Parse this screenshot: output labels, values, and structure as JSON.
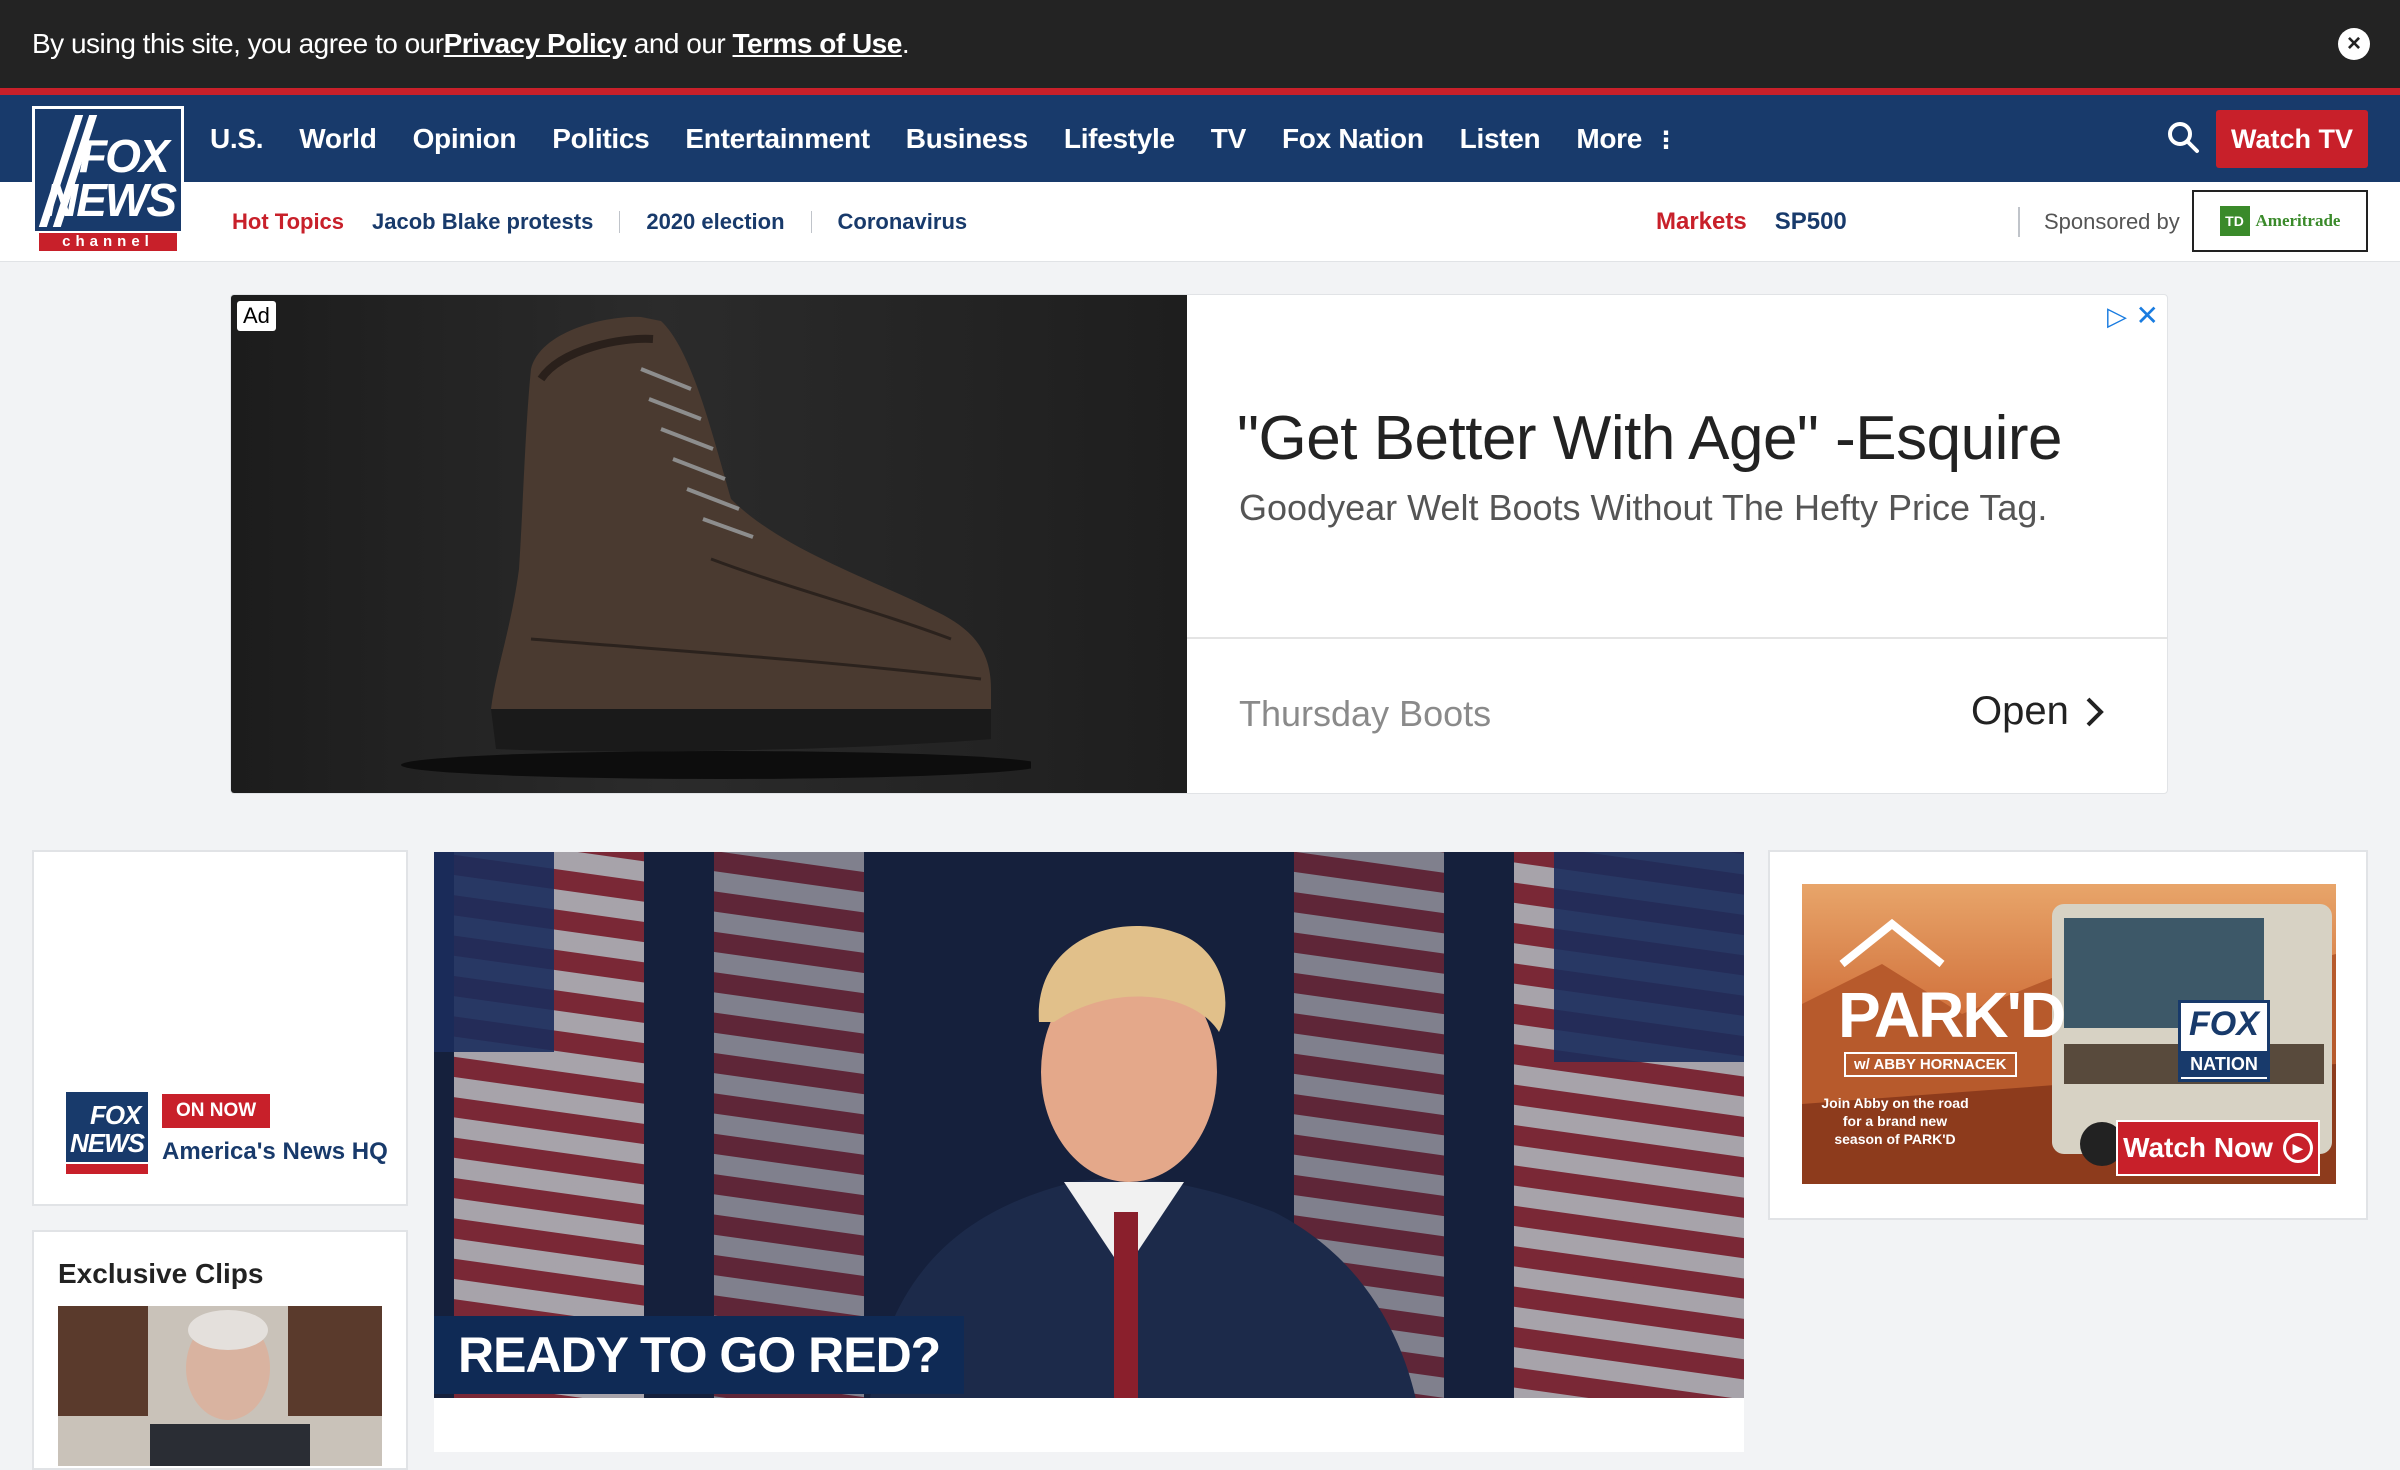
{
  "cookie": {
    "prefix": "By using this site, you agree to our ",
    "privacy": "Privacy Policy",
    "middle": " and our ",
    "terms": "Terms of Use",
    "suffix": ".",
    "close": "×"
  },
  "logo": {
    "line1": "FOX",
    "line2": "NEWS",
    "line3": "channel"
  },
  "nav": {
    "items": [
      "U.S.",
      "World",
      "Opinion",
      "Politics",
      "Entertainment",
      "Business",
      "Lifestyle",
      "TV",
      "Fox Nation",
      "Listen",
      "More"
    ],
    "more_dots": "⋮",
    "watch_tv": "Watch TV"
  },
  "subnav": {
    "hot_label": "Hot Topics",
    "topics": [
      "Jacob Blake protests",
      "2020 election",
      "Coronavirus"
    ],
    "markets": "Markets",
    "index": "SP500",
    "sponsored_by": "Sponsored by",
    "sponsor_logo": "TD",
    "sponsor_name": "Ameritrade"
  },
  "ad": {
    "badge": "Ad",
    "headline": "\"Get Better With Age\" -Esquire",
    "subline": "Goodyear Welt Boots Without The Hefty Price Tag.",
    "brand": "Thursday Boots",
    "open": "Open",
    "choices_icon": "▷",
    "close": "✕"
  },
  "on_now": {
    "logo1": "FOX",
    "logo2": "NEWS",
    "badge": "ON NOW",
    "show": "America's News HQ"
  },
  "clips": {
    "title": "Exclusive Clips"
  },
  "hero": {
    "tag": "READY TO GO RED?"
  },
  "promo": {
    "title": "PARK'D",
    "with": "w/ ABBY HORNACEK",
    "join": "Join Abby on the road for a brand new season of PARK'D",
    "fox": "FOX",
    "nation": "NATION",
    "watch": "Watch Now",
    "play": "▶"
  },
  "colors": {
    "navy": "#183a6b",
    "red": "#c8202a",
    "banner": "#232323"
  }
}
